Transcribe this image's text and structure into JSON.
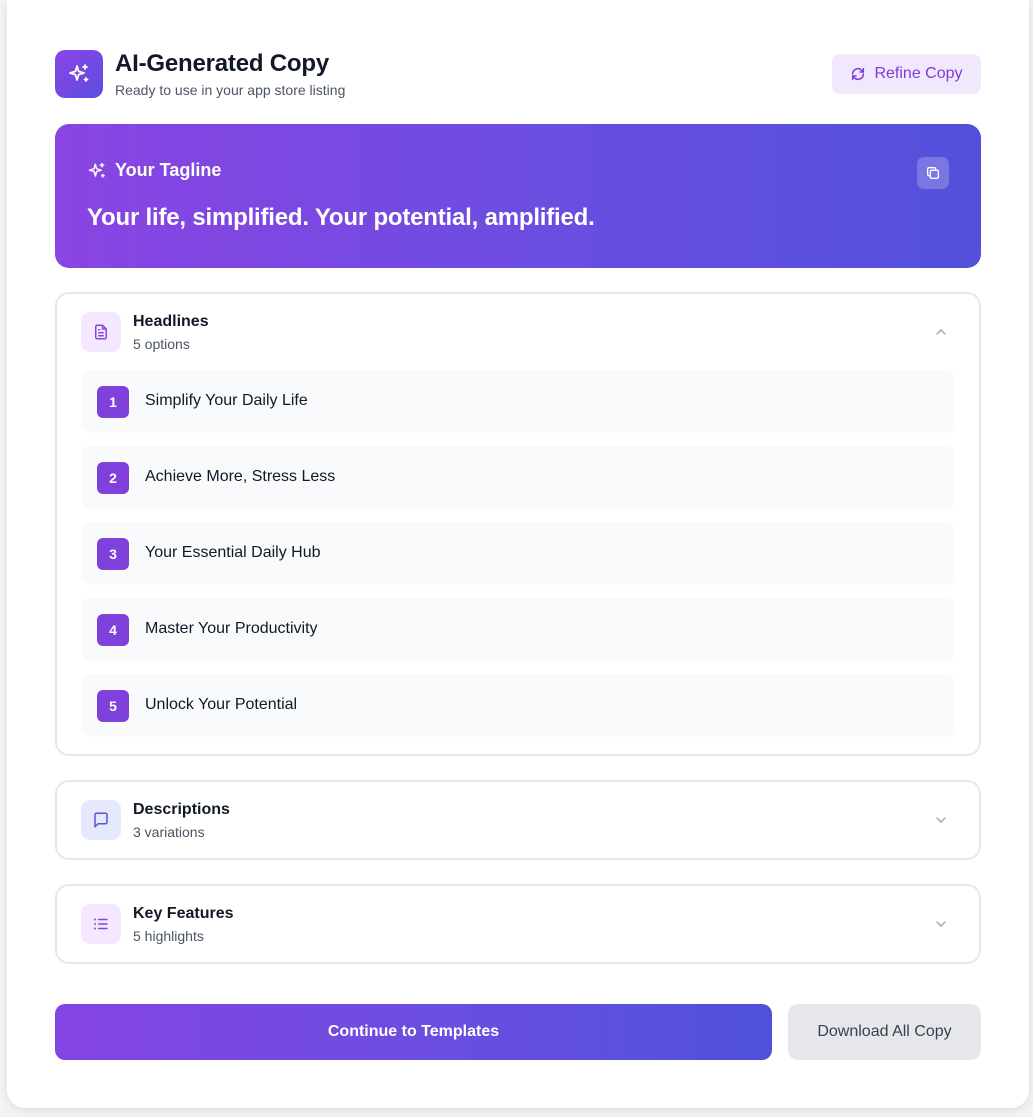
{
  "header": {
    "title": "AI-Generated Copy",
    "subtitle": "Ready to use in your app store listing",
    "refine_label": "Refine Copy"
  },
  "tagline": {
    "label": "Your Tagline",
    "text": "Your life, simplified. Your potential, amplified."
  },
  "headlines": {
    "title": "Headlines",
    "count": "5 options",
    "items": [
      {
        "num": "1",
        "text": "Simplify Your Daily Life"
      },
      {
        "num": "2",
        "text": "Achieve More, Stress Less"
      },
      {
        "num": "3",
        "text": "Your Essential Daily Hub"
      },
      {
        "num": "4",
        "text": "Master Your Productivity"
      },
      {
        "num": "5",
        "text": "Unlock Your Potential"
      }
    ]
  },
  "descriptions": {
    "title": "Descriptions",
    "count": "3 variations"
  },
  "features": {
    "title": "Key Features",
    "count": "5 highlights"
  },
  "actions": {
    "continue_label": "Continue to Templates",
    "download_label": "Download All Copy"
  },
  "colors": {
    "accent": "#8040dc",
    "gradient_start": "#8a44e2",
    "gradient_end": "#5250da"
  },
  "icons": {
    "logo": "sparkles-icon",
    "refine": "refresh-icon",
    "copy": "copy-icon",
    "headlines": "document-icon",
    "descriptions": "chat-bubble-icon",
    "features": "list-icon"
  }
}
